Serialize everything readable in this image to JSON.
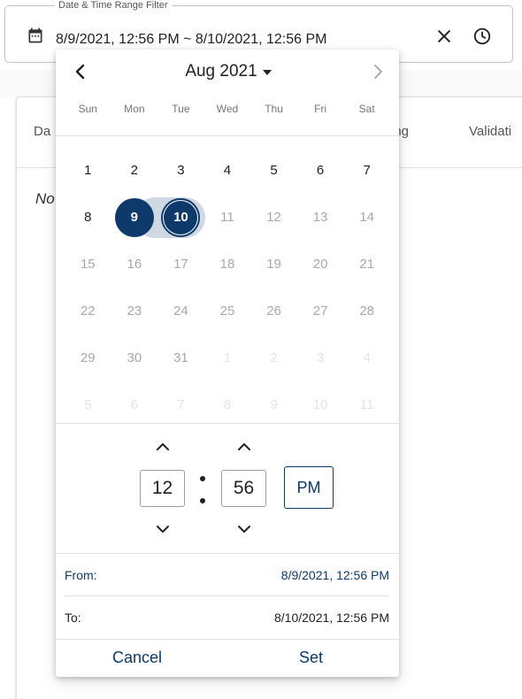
{
  "background": {
    "tabs": [
      "Da",
      "ring",
      "Validati"
    ],
    "italic_text": "No"
  },
  "field": {
    "label": "Date & Time Range Filter",
    "value": "8/9/2021, 12:56 PM ~ 8/10/2021, 12:56 PM",
    "icons": {
      "leading": "calendar-icon",
      "clear": "close-icon",
      "time": "clock-icon"
    }
  },
  "calendar": {
    "month_label": "Aug 2021",
    "weekdays": [
      "Sun",
      "Mon",
      "Tue",
      "Wed",
      "Thu",
      "Fri",
      "Sat"
    ],
    "weeks": [
      [
        "1",
        "2",
        "3",
        "4",
        "5",
        "6",
        "7"
      ],
      [
        "8",
        "9",
        "10",
        "11",
        "12",
        "13",
        "14"
      ],
      [
        "15",
        "16",
        "17",
        "18",
        "19",
        "20",
        "21"
      ],
      [
        "22",
        "23",
        "24",
        "25",
        "26",
        "27",
        "28"
      ],
      [
        "29",
        "30",
        "31",
        "1",
        "2",
        "3",
        "4"
      ],
      [
        "5",
        "6",
        "7",
        "8",
        "9",
        "10",
        "11"
      ]
    ],
    "selected_start": "9",
    "selected_end": "10"
  },
  "time": {
    "hour": "12",
    "minute": "56",
    "period": "PM"
  },
  "summary": {
    "from_label": "From:",
    "from_value": "8/9/2021, 12:56 PM",
    "to_label": "To:",
    "to_value": "8/10/2021, 12:56 PM"
  },
  "actions": {
    "cancel": "Cancel",
    "set": "Set"
  },
  "colors": {
    "accent": "#0d3a6b",
    "range_band": "#cfd8e3"
  }
}
